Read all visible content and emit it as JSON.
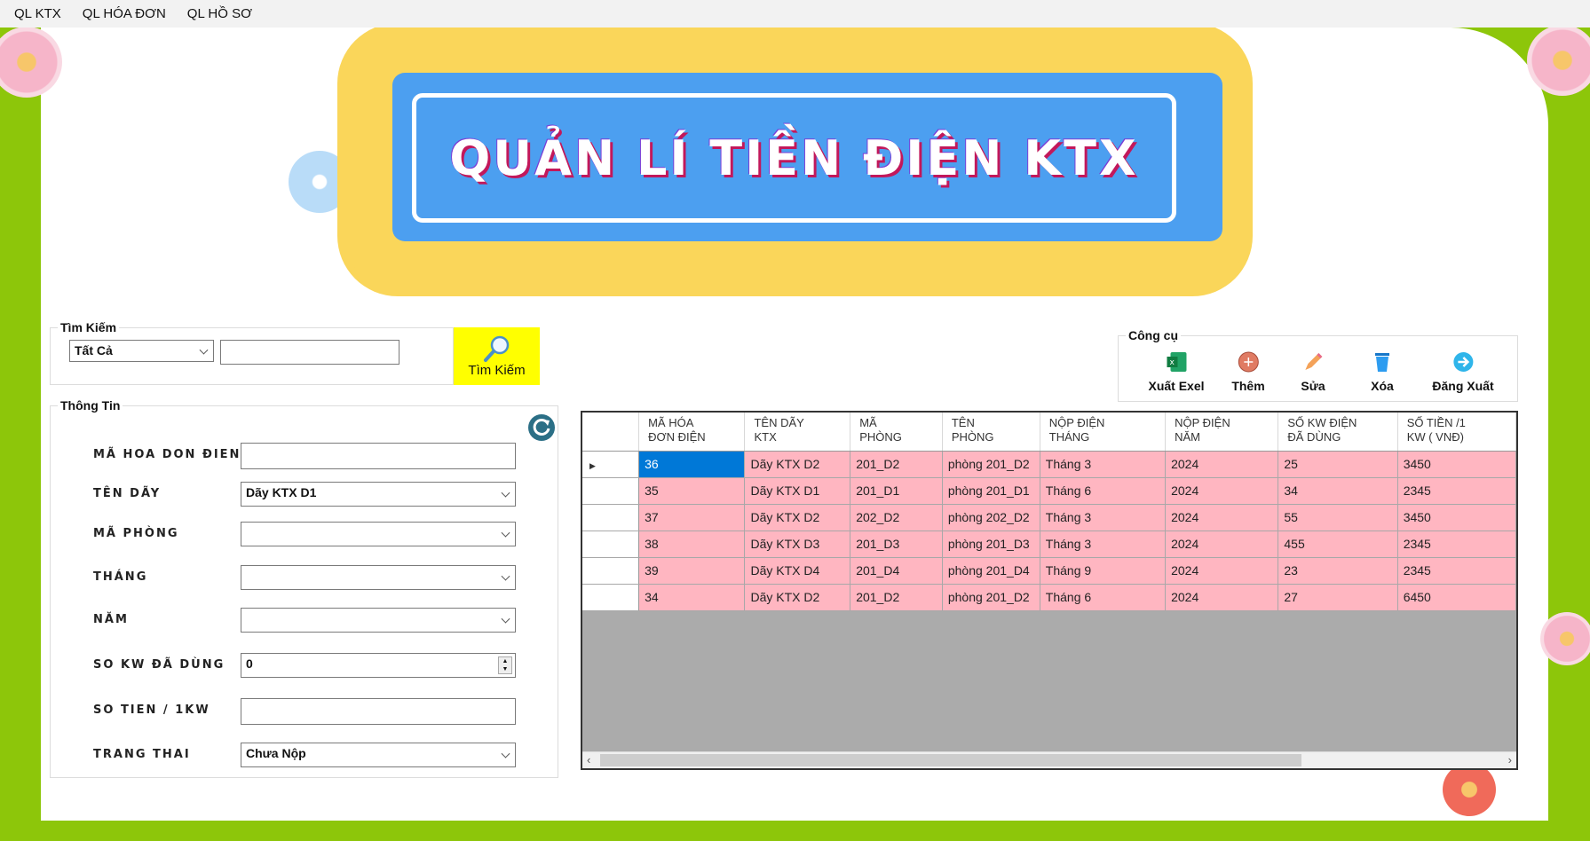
{
  "menu": [
    "QL KTX",
    "QL HÓA ĐƠN",
    "QL HỒ SƠ"
  ],
  "banner": {
    "title": "QUẢN LÍ TIỀN ĐIỆN KTX"
  },
  "search": {
    "group_title": "Tìm Kiếm",
    "filter_value": "Tất Cả",
    "query_value": "",
    "button_label": "Tìm Kiếm"
  },
  "info": {
    "group_title": "Thông Tin",
    "fields": [
      {
        "label": "MÃ HOA DON ĐIEN",
        "value": "",
        "type": "text"
      },
      {
        "label": "TÊN DÃY",
        "value": "Dãy KTX D1",
        "type": "combo"
      },
      {
        "label": "MÃ PHÒNG",
        "value": "",
        "type": "combo"
      },
      {
        "label": "THÁNG",
        "value": "",
        "type": "combo"
      },
      {
        "label": "NĂM",
        "value": "",
        "type": "combo"
      },
      {
        "label": "SO KW ĐÃ DÙNG",
        "value": "0",
        "type": "spin"
      },
      {
        "label": "SO TIEN / 1KW",
        "value": "",
        "type": "text"
      },
      {
        "label": "TRANG THAI",
        "value": "Chưa Nộp",
        "type": "combo"
      }
    ]
  },
  "tools": {
    "group_title": "Công cụ",
    "buttons": [
      {
        "label": "Xuất Exel",
        "icon": "excel-icon"
      },
      {
        "label": "Thêm",
        "icon": "add-icon"
      },
      {
        "label": "Sửa",
        "icon": "pencil-icon"
      },
      {
        "label": "Xóa",
        "icon": "trash-icon"
      },
      {
        "label": "Đăng Xuất",
        "icon": "logout-icon"
      }
    ]
  },
  "grid": {
    "columns": [
      "MÃ HÓA\nĐƠN ĐIỆN",
      "TÊN DÃY\nKTX",
      "MÃ\nPHÒNG",
      "TÊN\nPHÒNG",
      "NỘP ĐIỆN\nTHÁNG",
      "NỘP ĐIỆN\nNĂM",
      "SỐ KW ĐIỆN\nĐÃ DÙNG",
      "SỐ TIỀN /1\nKW ( VNĐ)"
    ],
    "rows": [
      [
        "36",
        "Dãy KTX D2",
        "201_D2",
        "phòng 201_D2",
        "Tháng 3",
        "2024",
        "25",
        "3450"
      ],
      [
        "35",
        "Dãy KTX D1",
        "201_D1",
        "phòng 201_D1",
        "Tháng 6",
        "2024",
        "34",
        "2345"
      ],
      [
        "37",
        "Dãy KTX D2",
        "202_D2",
        "phòng 202_D2",
        "Tháng 3",
        "2024",
        "55",
        "3450"
      ],
      [
        "38",
        "Dãy KTX D3",
        "201_D3",
        "phòng 201_D3",
        "Tháng 3",
        "2024",
        "455",
        "2345"
      ],
      [
        "39",
        "Dãy KTX D4",
        "201_D4",
        "phòng 201_D4",
        "Tháng 9",
        "2024",
        "23",
        "2345"
      ],
      [
        "34",
        "Dãy KTX D2",
        "201_D2",
        "phòng 201_D2",
        "Tháng 6",
        "2024",
        "27",
        "6450"
      ]
    ],
    "selected_row": 0
  },
  "colors": {
    "background": "#8dc60a",
    "banner_yellow": "#fad65a",
    "banner_blue": "#4c9ff0",
    "row_pink": "#ffb6c1",
    "search_button": "#ffff00",
    "selection": "#0078d7"
  }
}
